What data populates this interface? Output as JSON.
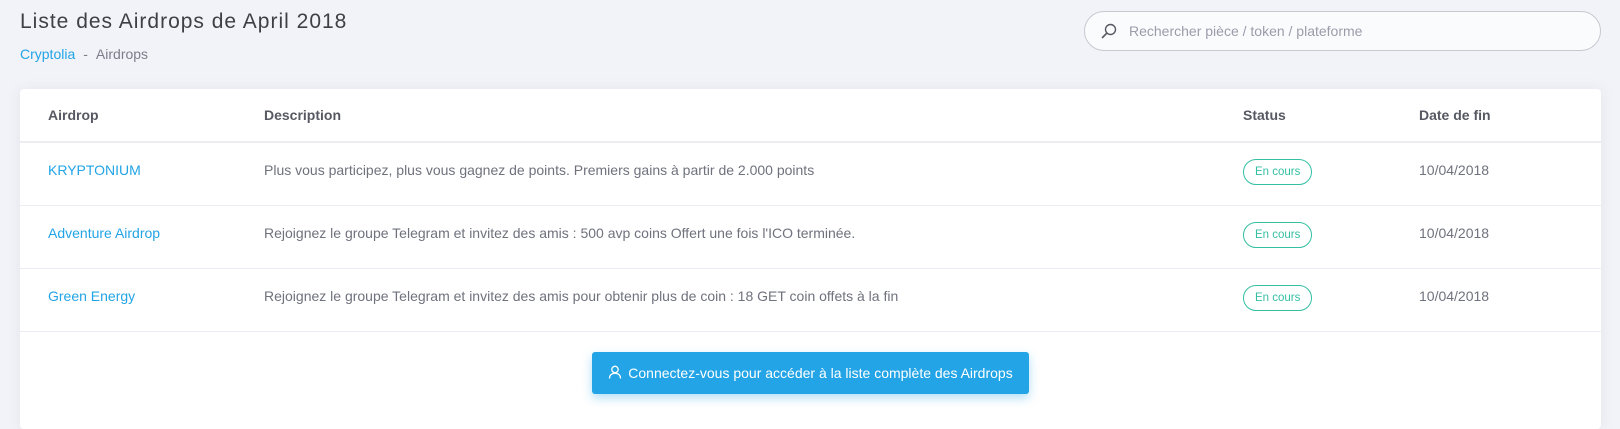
{
  "header": {
    "title": "Liste des Airdrops de April 2018",
    "breadcrumb": {
      "home": "Cryptolia",
      "separator": "-",
      "current": "Airdrops"
    }
  },
  "search": {
    "placeholder": "Rechercher pièce / token / plateforme",
    "value": ""
  },
  "table": {
    "columns": {
      "airdrop": "Airdrop",
      "description": "Description",
      "status": "Status",
      "end_date": "Date de fin"
    },
    "rows": [
      {
        "name": "KRYPTONIUM",
        "description": "Plus vous participez, plus vous gagnez de points. Premiers gains à partir de 2.000 points",
        "status": "En cours",
        "end_date": "10/04/2018"
      },
      {
        "name": "Adventure Airdrop",
        "description": "Rejoignez le groupe Telegram et invitez des amis : 500 avp coins Offert une fois l'ICO terminée.",
        "status": "En cours",
        "end_date": "10/04/2018"
      },
      {
        "name": "Green Energy",
        "description": "Rejoignez le groupe Telegram et invitez des amis pour obtenir plus de coin : 18 GET coin offets à la fin",
        "status": "En cours",
        "end_date": "10/04/2018"
      }
    ]
  },
  "login_button": {
    "label": "Connectez-vous pour accéder à la liste complète des Airdrops",
    "icon": "user-icon"
  },
  "colors": {
    "accent": "#22a4e6",
    "status_active": "#34bfa3",
    "background": "#f2f3f8"
  }
}
